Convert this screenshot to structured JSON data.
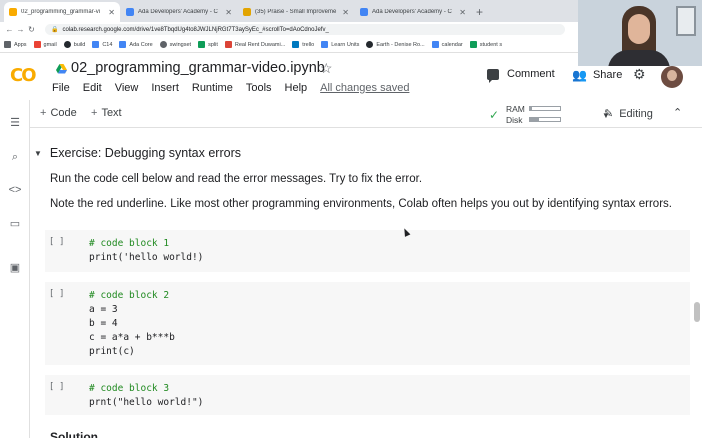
{
  "browser": {
    "tabs": [
      {
        "title": "02_programming_grammar-vi",
        "active": true,
        "favicon_color": "#f9ab00"
      },
      {
        "title": "Ada Developers' Academy - C",
        "active": false,
        "favicon_color": "#4285f4"
      },
      {
        "title": "(35) Praise - Small Improveme",
        "active": false,
        "favicon_color": "#e2a400"
      },
      {
        "title": "Ada Developers' Academy - C",
        "active": false,
        "favicon_color": "#4285f4"
      }
    ],
    "new_tab": "+",
    "url": "colab.research.google.com/drive/1ve8TbqdUg4to8JWJLNjRGt7T3aySyEc_#scrollTo=dAoCdnoJefv_",
    "bookmarks": [
      {
        "label": "Apps",
        "color": "#5f6368"
      },
      {
        "label": "gmail",
        "color": "#ea4335"
      },
      {
        "label": "build",
        "color": "#24292e"
      },
      {
        "label": "C14",
        "color": "#4285f4"
      },
      {
        "label": "Ada Core",
        "color": "#4285f4"
      },
      {
        "label": "swingset",
        "color": "#5f6368"
      },
      {
        "label": "split",
        "color": "#0f9d58"
      },
      {
        "label": "Real Rent Duwami...",
        "color": "#db4437"
      },
      {
        "label": "trello",
        "color": "#0079bf"
      },
      {
        "label": "Learn Units",
        "color": "#4285f4"
      },
      {
        "label": "Earth - Denise Ro...",
        "color": "#24292e"
      },
      {
        "label": "calendar",
        "color": "#4285f4"
      },
      {
        "label": "student s",
        "color": "#0f9d58"
      }
    ]
  },
  "colab": {
    "logo": "CO",
    "notebook_title": "02_programming_grammar-video.ipynb",
    "menu": [
      "File",
      "Edit",
      "View",
      "Insert",
      "Runtime",
      "Tools",
      "Help"
    ],
    "save_status": "All changes saved",
    "comment_label": "Comment",
    "share_label": "Share",
    "toolbar": {
      "add_code": "Code",
      "add_text": "Text",
      "ram_label": "RAM",
      "disk_label": "Disk",
      "ram_usage": 0.06,
      "disk_usage": 0.3,
      "editing_label": "Editing"
    }
  },
  "notebook": {
    "section_title": "Exercise: Debugging syntax errors",
    "paragraph_1": "Run the code cell below and read the error messages. Try to fix the error.",
    "paragraph_2": "Note the red underline. Like most other programming environments, Colab often helps you out by identifying syntax errors.",
    "run_marker": "[ ]",
    "cells": [
      {
        "lines": [
          {
            "type": "comment",
            "text": "# code block 1"
          },
          {
            "type": "code",
            "text": "print('hello world!)"
          }
        ]
      },
      {
        "lines": [
          {
            "type": "comment",
            "text": "# code block 2"
          },
          {
            "type": "code",
            "text": "a = 3"
          },
          {
            "type": "code",
            "text": "b = 4"
          },
          {
            "type": "code",
            "text": "c = a*a + b***b"
          },
          {
            "type": "code",
            "text": "print(c)"
          }
        ]
      },
      {
        "lines": [
          {
            "type": "comment",
            "text": "# code block 3"
          },
          {
            "type": "code",
            "text": "prnt(\"hello world!\")"
          }
        ]
      }
    ],
    "next_heading": "Solution"
  }
}
